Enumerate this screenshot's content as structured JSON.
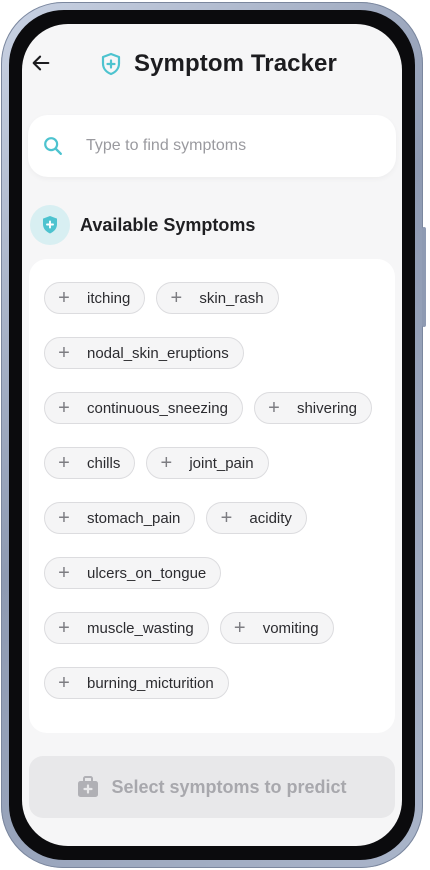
{
  "header": {
    "title": "Symptom Tracker",
    "back_icon": "arrow-left-icon",
    "title_icon": "shield-plus-icon",
    "accent_color": "#4dc3cf"
  },
  "search": {
    "placeholder": "Type to find symptoms",
    "value": "",
    "icon": "search-icon"
  },
  "available": {
    "title": "Available Symptoms",
    "icon": "shield-plus-icon",
    "chip_icon": "plus-icon",
    "symptoms": [
      "itching",
      "skin_rash",
      "nodal_skin_eruptions",
      "continuous_sneezing",
      "shivering",
      "chills",
      "joint_pain",
      "stomach_pain",
      "acidity",
      "ulcers_on_tongue",
      "muscle_wasting",
      "vomiting",
      "burning_micturition"
    ]
  },
  "action": {
    "label": "Select symptoms to predict",
    "icon": "medical-kit-icon",
    "disabled": true
  }
}
